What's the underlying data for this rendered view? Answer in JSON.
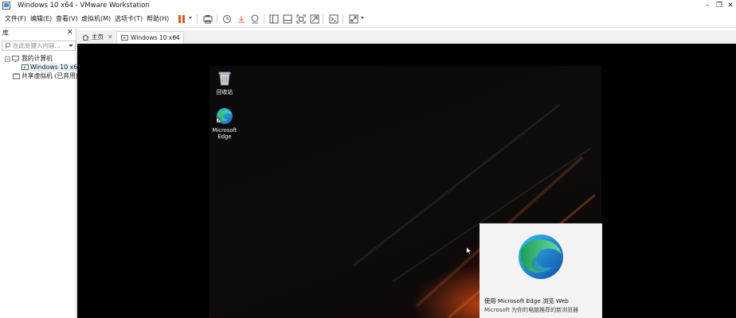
{
  "window": {
    "title": "Windows 10 x64 - VMware Workstation",
    "minimize": "–",
    "restore": "❐",
    "close": "✕"
  },
  "menu": {
    "items": [
      "文件(F)",
      "编辑(E)",
      "查看(V)",
      "虚拟机(M)",
      "选项卡(T)",
      "帮助(H)"
    ]
  },
  "toolbar": {
    "icons": [
      "pause-icon",
      "send-ctrl-alt-del-icon",
      "snapshot-icon",
      "revert-snapshot-icon",
      "snapshot-manager-icon",
      "show-library-icon",
      "thumbnail-bar-icon",
      "full-screen-icon",
      "unity-icon",
      "console-icon",
      "stretch-guest-icon"
    ]
  },
  "library": {
    "title": "库",
    "close": "✕",
    "search_placeholder": "在此处键入内容...",
    "tree": {
      "root": "我的计算机",
      "vm": "Windows 10 x64",
      "shared": "共享虚拟机 (已弃用)"
    }
  },
  "tabs": [
    {
      "label": "主页",
      "close": "✕",
      "active": false
    },
    {
      "label": "Windows 10 x64",
      "close": "✕",
      "active": true
    }
  ],
  "guest": {
    "desktop_icons": [
      {
        "label": "回收站",
        "icon": "recycle-bin-icon"
      },
      {
        "label": "Microsoft Edge",
        "icon": "edge-icon"
      }
    ],
    "toast": {
      "title": "使用 Microsoft Edge 浏览 Web",
      "subtitle": "Microsoft 为你的电脑推荐的新浏览器"
    }
  },
  "colors": {
    "accent_pause": "#e8541a",
    "vm_background": "#000000",
    "toast_background": "#f3f3f3"
  }
}
